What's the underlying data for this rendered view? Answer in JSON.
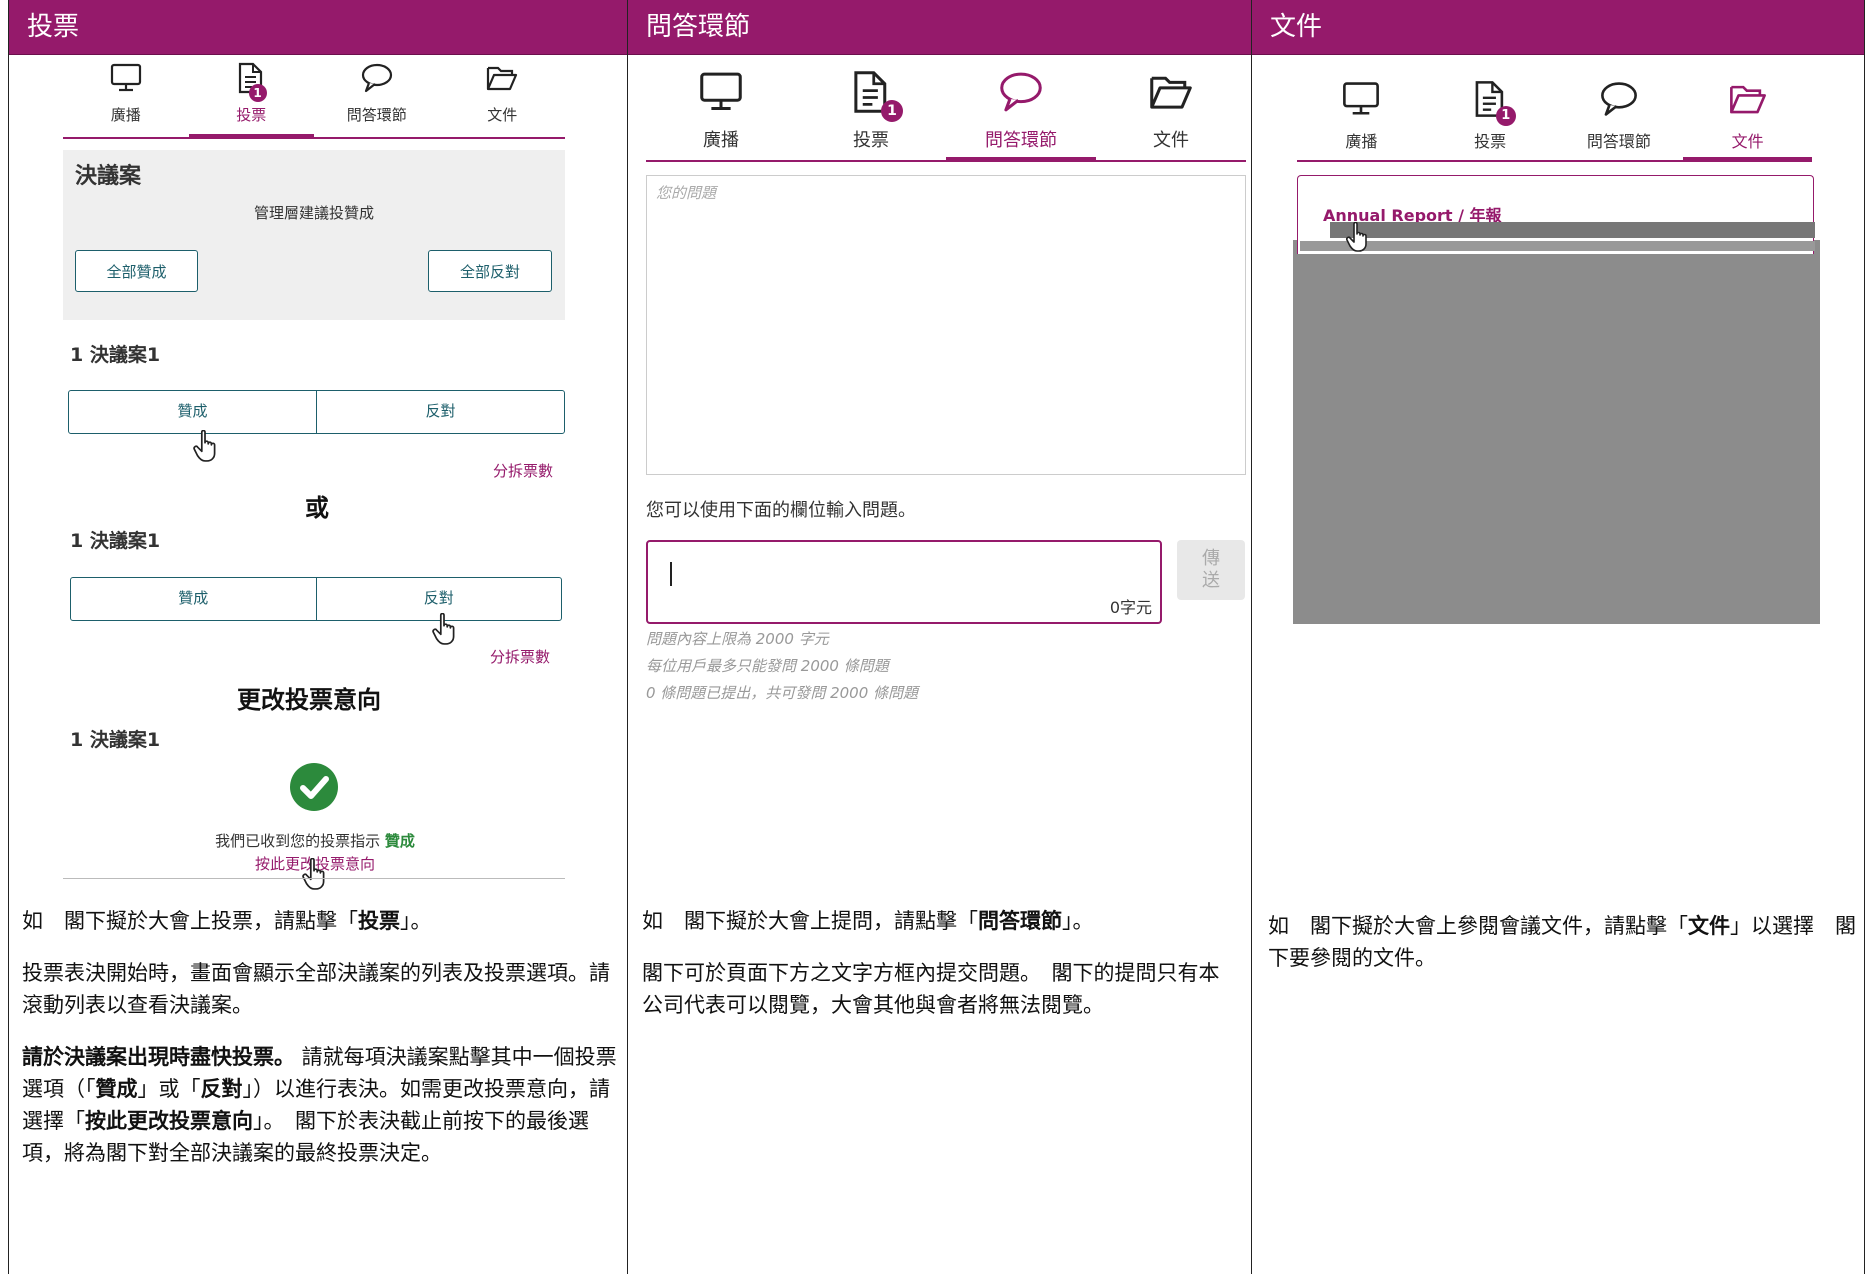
{
  "columns": [
    {
      "header": "投票"
    },
    {
      "header": "問答環節"
    },
    {
      "header": "文件"
    }
  ],
  "tabs": [
    {
      "label": "廣播",
      "icon": "monitor-icon"
    },
    {
      "label": "投票",
      "icon": "document-icon",
      "badge": "1"
    },
    {
      "label": "問答環節",
      "icon": "chat-bubble-icon"
    },
    {
      "label": "文件",
      "icon": "folder-icon"
    }
  ],
  "voting": {
    "resolutions_title": "決議案",
    "management_note": "管理層建議投贊成",
    "all_for": "全部贊成",
    "all_against": "全部反對",
    "resolution_label": "1 決議案1",
    "for": "贊成",
    "against": "反對",
    "split_votes": "分拆票數",
    "or": "或",
    "change_intention": "更改投票意向",
    "received_prefix": "我們已收到您的投票指示",
    "received_choice": "贊成",
    "change_link": "按此更改投票意向"
  },
  "qa": {
    "placeholder": "您的問題",
    "hint": "您可以使用下面的欄位輸入問題。",
    "char_count": "0字元",
    "send": "傳送",
    "notes": [
      "問題內容上限為 2000 字元",
      "每位用戶最多只能發問 2000 條問題",
      "0 條問題已提出，共可發問 2000 條問題"
    ]
  },
  "documents": {
    "card_title": "Annual Report / 年報"
  },
  "descriptions": {
    "vote": {
      "p1_pre": "如　閣下擬於大會上投票，請點擊「",
      "p1_bold": "投票",
      "p1_post": "」。",
      "p2": "投票表決開始時，畫面會顯示全部決議案的列表及投票選項。請滾動列表以查看決議案。",
      "p3_bold1": "請於決議案出現時盡快投票。",
      "p3_text1": " 請就每項決議案點擊其中一個投票選項（「",
      "p3_bold2": "贊成",
      "p3_text2": "」或「",
      "p3_bold3": "反對",
      "p3_text3": "」）以進行表決。如需更改投票意向，請選擇「",
      "p3_bold4": "按此更改投票意向",
      "p3_text4": "」。　閣下於表決截止前按下的最後選項，將為閣下對全部決議案的最終投票決定。"
    },
    "qa": {
      "p1_pre": "如　閣下擬於大會上提問，請點擊「",
      "p1_bold": "問答環節",
      "p1_post": "」。",
      "p2": "閣下可於頁面下方之文字方框內提交問題。　閣下的提問只有本公司代表可以閱覽，大會其他與會者將無法閱覽。"
    },
    "docs": {
      "p1_pre": "如　閣下擬於大會上參閱會議文件，請點擊「",
      "p1_bold": "文件",
      "p1_post": "」以選擇　閣下要參閱的文件。"
    }
  },
  "colors": {
    "brand": "#951a6b",
    "teal": "#1d5f6b",
    "success": "#2c8a3c"
  }
}
